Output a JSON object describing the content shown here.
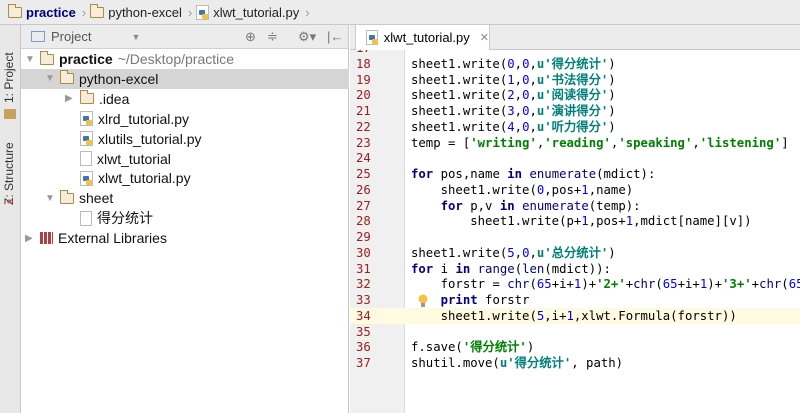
{
  "breadcrumb": [
    "practice",
    "python-excel",
    "xlwt_tutorial.py"
  ],
  "tool_strip": {
    "project": "1: Project",
    "structure": "Z: Structure"
  },
  "project_panel": {
    "title": "Project",
    "tree": [
      {
        "label": "practice",
        "suffix": "~/Desktop/practice",
        "icon": "folder",
        "arrow": "down",
        "depth": 0,
        "bold": true
      },
      {
        "label": "python-excel",
        "icon": "folder",
        "arrow": "down",
        "depth": 1,
        "selected": true
      },
      {
        "label": ".idea",
        "icon": "folder",
        "arrow": "right",
        "depth": 2
      },
      {
        "label": "xlrd_tutorial.py",
        "icon": "python-file",
        "depth": 2
      },
      {
        "label": "xlutils_tutorial.py",
        "icon": "python-file",
        "depth": 2
      },
      {
        "label": "xlwt_tutorial",
        "icon": "file",
        "depth": 2
      },
      {
        "label": "xlwt_tutorial.py",
        "icon": "python-file",
        "depth": 2
      },
      {
        "label": "sheet",
        "icon": "folder",
        "arrow": "down",
        "depth": 1
      },
      {
        "label": "得分统计",
        "icon": "file",
        "depth": 2
      },
      {
        "label": "External Libraries",
        "icon": "library",
        "arrow": "right",
        "depth": 0
      }
    ]
  },
  "editor": {
    "tab": "xlwt_tutorial.py",
    "current_line": 34,
    "lines": [
      {
        "n": "17",
        "tokens": []
      },
      {
        "n": "18",
        "tokens": [
          [
            "t",
            "sheet1.write("
          ],
          [
            "n",
            "0"
          ],
          [
            "t",
            ","
          ],
          [
            "n",
            "0"
          ],
          [
            "t",
            ","
          ],
          [
            "u",
            "u'得分统计'"
          ],
          [
            "t",
            ")"
          ]
        ]
      },
      {
        "n": "19",
        "tokens": [
          [
            "t",
            "sheet1.write("
          ],
          [
            "n",
            "1"
          ],
          [
            "t",
            ","
          ],
          [
            "n",
            "0"
          ],
          [
            "t",
            ","
          ],
          [
            "u",
            "u'书法得分'"
          ],
          [
            "t",
            ")"
          ]
        ]
      },
      {
        "n": "20",
        "tokens": [
          [
            "t",
            "sheet1.write("
          ],
          [
            "n",
            "2"
          ],
          [
            "t",
            ","
          ],
          [
            "n",
            "0"
          ],
          [
            "t",
            ","
          ],
          [
            "u",
            "u'阅读得分'"
          ],
          [
            "t",
            ")"
          ]
        ]
      },
      {
        "n": "21",
        "tokens": [
          [
            "t",
            "sheet1.write("
          ],
          [
            "n",
            "3"
          ],
          [
            "t",
            ","
          ],
          [
            "n",
            "0"
          ],
          [
            "t",
            ","
          ],
          [
            "u",
            "u'演讲得分'"
          ],
          [
            "t",
            ")"
          ]
        ]
      },
      {
        "n": "22",
        "tokens": [
          [
            "t",
            "sheet1.write("
          ],
          [
            "n",
            "4"
          ],
          [
            "t",
            ","
          ],
          [
            "n",
            "0"
          ],
          [
            "t",
            ","
          ],
          [
            "u",
            "u'听力得分'"
          ],
          [
            "t",
            ")"
          ]
        ]
      },
      {
        "n": "23",
        "tokens": [
          [
            "t",
            "temp = ["
          ],
          [
            "s",
            "'writing'"
          ],
          [
            "t",
            ","
          ],
          [
            "s",
            "'reading'"
          ],
          [
            "t",
            ","
          ],
          [
            "s",
            "'speaking'"
          ],
          [
            "t",
            ","
          ],
          [
            "s",
            "'listening'"
          ],
          [
            "t",
            "]"
          ]
        ]
      },
      {
        "n": "24",
        "tokens": []
      },
      {
        "n": "25",
        "tokens": [
          [
            "k",
            "for"
          ],
          [
            "t",
            " pos,name "
          ],
          [
            "k",
            "in"
          ],
          [
            "t",
            " "
          ],
          [
            "b",
            "enumerate"
          ],
          [
            "t",
            "(mdict):"
          ]
        ]
      },
      {
        "n": "26",
        "tokens": [
          [
            "t",
            "    sheet1.write("
          ],
          [
            "n",
            "0"
          ],
          [
            "t",
            ",pos+"
          ],
          [
            "n",
            "1"
          ],
          [
            "t",
            ",name)"
          ]
        ]
      },
      {
        "n": "27",
        "tokens": [
          [
            "t",
            "    "
          ],
          [
            "k",
            "for"
          ],
          [
            "t",
            " p,v "
          ],
          [
            "k",
            "in"
          ],
          [
            "t",
            " "
          ],
          [
            "b",
            "enumerate"
          ],
          [
            "t",
            "(temp):"
          ]
        ]
      },
      {
        "n": "28",
        "tokens": [
          [
            "t",
            "        sheet1.write(p+"
          ],
          [
            "n",
            "1"
          ],
          [
            "t",
            ",pos+"
          ],
          [
            "n",
            "1"
          ],
          [
            "t",
            ",mdict[name][v])"
          ]
        ]
      },
      {
        "n": "29",
        "tokens": []
      },
      {
        "n": "30",
        "tokens": [
          [
            "t",
            "sheet1.write("
          ],
          [
            "n",
            "5"
          ],
          [
            "t",
            ","
          ],
          [
            "n",
            "0"
          ],
          [
            "t",
            ","
          ],
          [
            "u",
            "u'总分统计'"
          ],
          [
            "t",
            ")"
          ]
        ]
      },
      {
        "n": "31",
        "tokens": [
          [
            "k",
            "for"
          ],
          [
            "t",
            " i "
          ],
          [
            "k",
            "in"
          ],
          [
            "t",
            " "
          ],
          [
            "b",
            "range"
          ],
          [
            "t",
            "("
          ],
          [
            "b",
            "len"
          ],
          [
            "t",
            "(mdict)):"
          ]
        ]
      },
      {
        "n": "32",
        "tokens": [
          [
            "t",
            "    forstr = "
          ],
          [
            "b",
            "chr"
          ],
          [
            "t",
            "("
          ],
          [
            "n",
            "65"
          ],
          [
            "t",
            "+i+"
          ],
          [
            "n",
            "1"
          ],
          [
            "t",
            ")+"
          ],
          [
            "s",
            "'2+'"
          ],
          [
            "t",
            "+"
          ],
          [
            "b",
            "chr"
          ],
          [
            "t",
            "("
          ],
          [
            "n",
            "65"
          ],
          [
            "t",
            "+i+"
          ],
          [
            "n",
            "1"
          ],
          [
            "t",
            ")+"
          ],
          [
            "s",
            "'3+'"
          ],
          [
            "t",
            "+"
          ],
          [
            "b",
            "chr"
          ],
          [
            "t",
            "("
          ],
          [
            "n",
            "65"
          ]
        ]
      },
      {
        "n": "33",
        "tokens": [
          [
            "t",
            "    "
          ],
          [
            "k",
            "print"
          ],
          [
            "t",
            " forstr"
          ]
        ]
      },
      {
        "n": "34",
        "tokens": [
          [
            "t",
            "    sheet1.write("
          ],
          [
            "n",
            "5"
          ],
          [
            "t",
            ",i+"
          ],
          [
            "n",
            "1"
          ],
          [
            "t",
            ",xlwt.Formula(forstr))"
          ]
        ]
      },
      {
        "n": "35",
        "tokens": []
      },
      {
        "n": "36",
        "tokens": [
          [
            "t",
            "f.save("
          ],
          [
            "s",
            "'得分统计'"
          ],
          [
            "t",
            ")"
          ]
        ]
      },
      {
        "n": "37",
        "tokens": [
          [
            "t",
            "shutil.move("
          ],
          [
            "u",
            "u'得分统计'"
          ],
          [
            "t",
            ", path)"
          ]
        ]
      }
    ]
  }
}
